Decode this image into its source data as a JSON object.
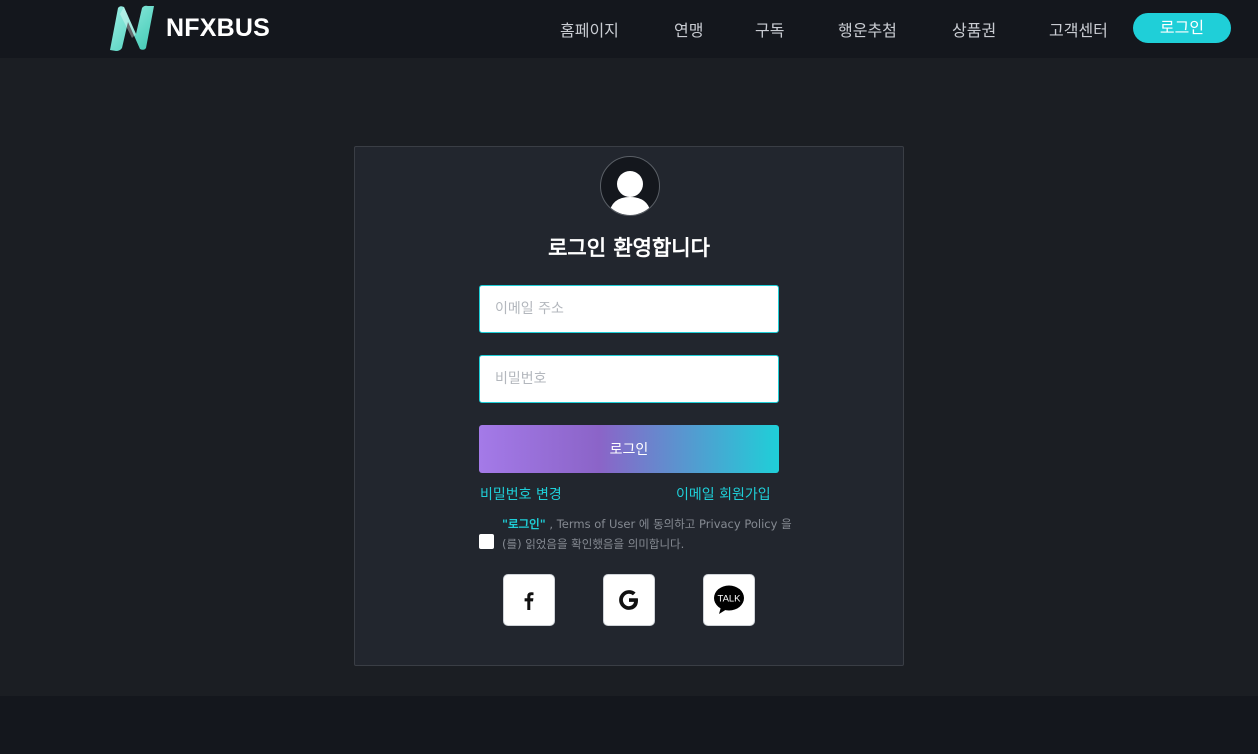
{
  "header": {
    "brand": "NFXBUS",
    "nav": [
      {
        "label": "홈페이지",
        "name": "nav-home"
      },
      {
        "label": "연맹",
        "name": "nav-alliance"
      },
      {
        "label": "구독",
        "name": "nav-subscribe"
      },
      {
        "label": "행운추첨",
        "name": "nav-lucky-draw"
      },
      {
        "label": "상품권",
        "name": "nav-voucher"
      },
      {
        "label": "고객센터",
        "name": "nav-support"
      }
    ],
    "login_button": "로그인"
  },
  "login_card": {
    "title": "로그인 환영합니다",
    "email_placeholder": "이메일 주소",
    "password_placeholder": "비밀번호",
    "submit_label": "로그인",
    "change_password_link": "비밀번호 변경",
    "email_signup_link": "이메일 회원가입",
    "terms": {
      "highlight": "\"로그인\"",
      "text_1": " , Terms of User 에 동의하고 Privacy Policy 을(를) 읽었음을 확인했음을 의미합니다."
    },
    "social": [
      {
        "name": "facebook-login-button",
        "icon": "facebook-icon"
      },
      {
        "name": "google-login-button",
        "icon": "google-icon"
      },
      {
        "name": "kakaotalk-login-button",
        "icon": "kakaotalk-icon",
        "label": "TALK"
      }
    ]
  },
  "colors": {
    "accent": "#1fcfd8",
    "gradient_start": "#a47ae8",
    "page_bg": "#1b1e23",
    "header_bg": "#14171d",
    "card_bg": "#22262e"
  }
}
